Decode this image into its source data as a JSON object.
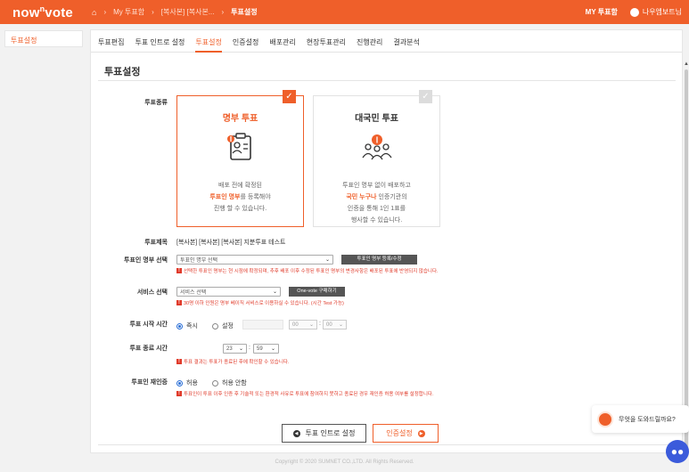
{
  "app": {
    "logo": "now",
    "logo_sup": "n",
    "logo_end": "vote"
  },
  "breadcrumb": {
    "items": [
      "My 투표함",
      "[복사본] [복사본...",
      "투표설정"
    ]
  },
  "header_right": {
    "my_box": "MY 투표함",
    "user": "나우엠보트님"
  },
  "sidebar": {
    "items": [
      {
        "label": "투표설정"
      }
    ]
  },
  "tabs": [
    {
      "label": "투표편집"
    },
    {
      "label": "투표 인트로 설정"
    },
    {
      "label": "투표설정"
    },
    {
      "label": "인증설정"
    },
    {
      "label": "배포관리"
    },
    {
      "label": "현장투표관리"
    },
    {
      "label": "진행관리"
    },
    {
      "label": "결과분석"
    }
  ],
  "section_title": "투표설정",
  "vote_type": {
    "label": "투표종류",
    "roster": {
      "title": "명부 투표",
      "line1": "배포 전에 확정된",
      "line2_em": "투표인 명부",
      "line2_rest": "를 등록해야",
      "line3": "진행 할 수 있습니다."
    },
    "public": {
      "title": "대국민 투표",
      "line1": "투표인 명부 없이 배포하고",
      "line2_em": "국민 누구나",
      "line2_rest": " 인증기관의",
      "line3": "인증을 통해 1인 1표를",
      "line4": "행사할 수 있습니다."
    }
  },
  "vote_title": {
    "label": "투표제목",
    "value": "[복사본] [복사본] [복사본] 지분투표 테스트"
  },
  "roster_select": {
    "label": "투표인 명부 선택",
    "selected": "투표인 명부 선택",
    "button": "투표인 명부 등록/수정",
    "note": "선택한 투표인 명부는 현 시점에 확정되며, 추후 배포 이후 수정된 투표인 명부의 변경사항은 배포된 투표에 반영되지 않습니다."
  },
  "service": {
    "label": "서비스 선택",
    "selected": "서비스 선택",
    "button": "One-vote 구매하기",
    "note": "30명 이하 인원은 명부 베이직 서비스로 이용하실 수 있습니다. (시간 Test 가능)"
  },
  "start_time": {
    "label": "투표 시작 시간",
    "opt_now": "즉시",
    "opt_set": "설정",
    "hour": "00",
    "minute": "00"
  },
  "end_time": {
    "label": "투표 종료 시간",
    "hour": "23",
    "minute": "59",
    "note": "투표 결과는 투표가 종료된 후에 확인할 수 있습니다."
  },
  "revote": {
    "label": "투표인 재인증",
    "opt_allow": "허용",
    "opt_deny": "허용 안함",
    "note": "투표인이 투표 이후 인증 후 기술적 또는 환경적 사유로 투표에 참여하지 못하고 종료된 경우 재인증 허용 여부를 설정합니다."
  },
  "buttons": {
    "prev": "투표 인트로 설정",
    "next": "인증설정"
  },
  "footer": "Copyright © 2020 SUMNET CO.,LTD. All Rights Reserved.",
  "help": {
    "text": "무엇을 도와드릴까요?"
  },
  "colors": {
    "accent": "#ef5f2a",
    "note_red": "#e03a2a"
  }
}
